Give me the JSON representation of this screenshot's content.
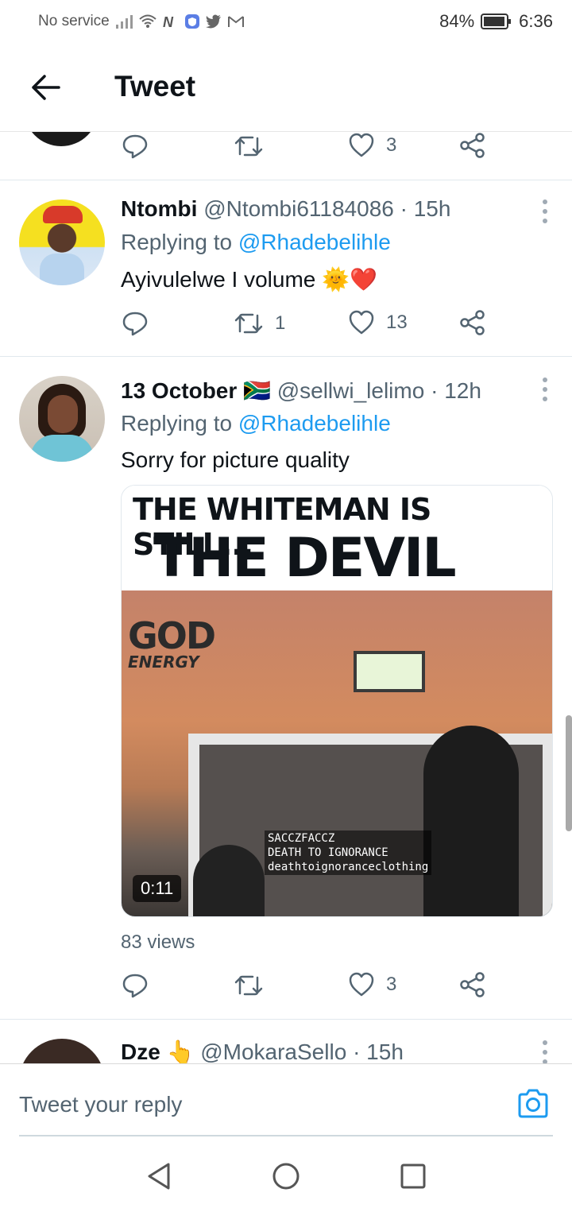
{
  "status_bar": {
    "carrier": "No service",
    "battery": "84%",
    "time": "6:36"
  },
  "header": {
    "title": "Tweet"
  },
  "top_tweet_actions": {
    "likes": "3"
  },
  "tweets": [
    {
      "name": "Ntombi",
      "handle": "@Ntombi61184086",
      "time": "15h",
      "replying_prefix": "Replying to",
      "replying_to": "@Rhadebelihle",
      "text": "Ayivulelwe I volume 🌞❤️",
      "retweets": "1",
      "likes": "13"
    },
    {
      "name": "13 October 🇿🇦",
      "handle": "@sellwi_lelimo",
      "time": "12h",
      "replying_prefix": "Replying to",
      "replying_to": "@Rhadebelihle",
      "text": "Sorry for picture quality",
      "media": {
        "headline_1": "THE WHITEMAN IS STILL...",
        "headline_2": "THE DEVIL",
        "watermark_1": "GOD",
        "watermark_2": "ENERGY",
        "caption_1": "SACCZFACCZ",
        "caption_2": "DEATH TO IGNORANCE",
        "caption_3": "deathtoignoranceclothing",
        "duration": "0:11"
      },
      "views": "83 views",
      "likes": "3"
    },
    {
      "name": "Dze 👆",
      "handle": "@MokaraSello",
      "time": "15h"
    }
  ],
  "reply_box": {
    "placeholder": "Tweet your reply"
  },
  "icons": [
    "back-arrow-icon",
    "reply-icon",
    "retweet-icon",
    "like-icon",
    "share-icon",
    "more-icon",
    "camera-icon",
    "nav-back-icon",
    "nav-home-icon",
    "nav-recents-icon"
  ]
}
